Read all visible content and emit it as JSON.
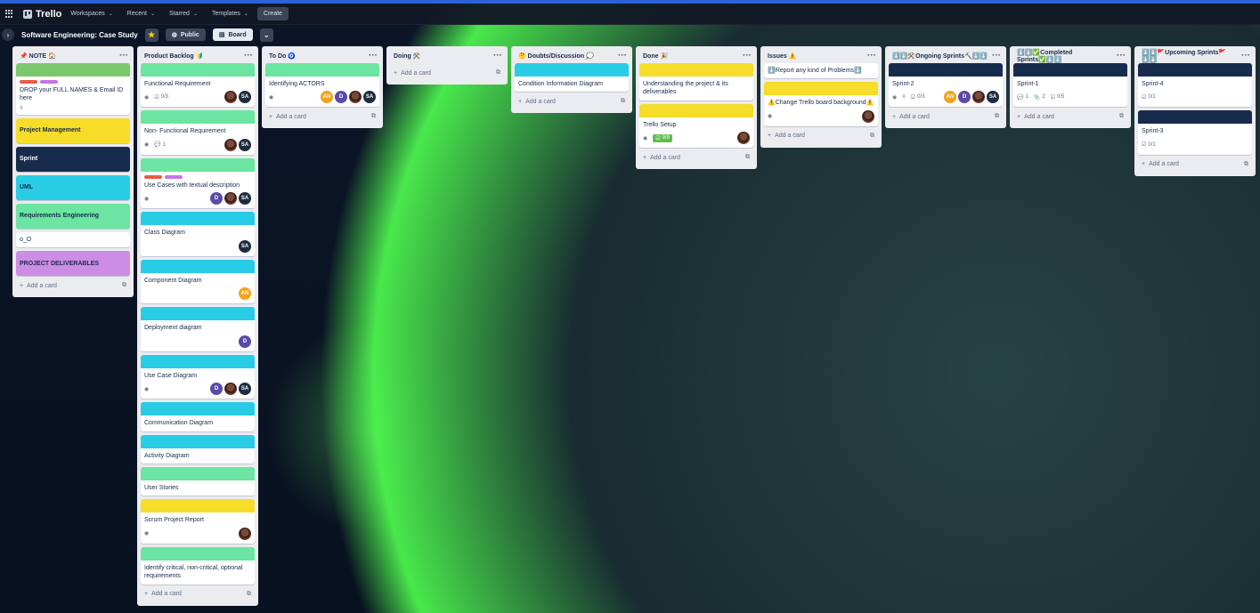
{
  "app": {
    "brand": "Trello",
    "menu": [
      "Workspaces",
      "Recent",
      "Starred",
      "Templates"
    ],
    "create_label": "Create"
  },
  "board": {
    "title": "Software Engineering: Case Study",
    "visibility": "Public",
    "view": "Board"
  },
  "lists": [
    {
      "title": "📌 NOTE 🏠",
      "cards": [
        {
          "type": "cover",
          "cover": "#7bc86c",
          "title": "DROP your FULL NAMES & Email ID here",
          "labels": [
            "#eb5a46",
            "#c377e0"
          ]
        },
        {
          "type": "solid",
          "color": "#f5dd29",
          "text": "Project Management",
          "textColor": "#172b4d"
        },
        {
          "type": "solid",
          "color": "#172b4d",
          "text": "Sprint",
          "textColor": "#ffffff"
        },
        {
          "type": "solid",
          "color": "#29cce5",
          "text": "UML",
          "textColor": "#172b4d"
        },
        {
          "type": "solid",
          "color": "#6be5a1",
          "text": "Requirements Engineering",
          "textColor": "#172b4d"
        },
        {
          "type": "plain",
          "title": "o_O"
        },
        {
          "type": "solid",
          "color": "#cd8de5",
          "text": "PROJECT DELIVERABLES",
          "textColor": "#172b4d"
        }
      ],
      "add_label": "Add a card"
    },
    {
      "title": "Product Backlog 🔰",
      "cards": [
        {
          "type": "cover",
          "cover": "#6be5a1",
          "title": "Functional Requirement",
          "badges": [
            "watch",
            "checklist:0/3"
          ],
          "members": [
            "photo",
            "SA"
          ]
        },
        {
          "type": "cover",
          "cover": "#6be5a1",
          "title": "Non- Functional Requirement",
          "badges": [
            "watch",
            "comments:1"
          ],
          "members": [
            "photo",
            "SA"
          ]
        },
        {
          "type": "cover",
          "cover": "#6be5a1",
          "title": "Use Cases with textual description",
          "labels": [
            "#eb5a46",
            "#c377e0"
          ],
          "badges": [
            "watch"
          ],
          "members": [
            "D",
            "photo",
            "SA"
          ]
        },
        {
          "type": "cover",
          "cover": "#29cce5",
          "title": "Class Diagram",
          "members": [
            "SA"
          ]
        },
        {
          "type": "cover",
          "cover": "#29cce5",
          "title": "Component Diagram",
          "members": [
            "AN"
          ]
        },
        {
          "type": "cover",
          "cover": "#29cce5",
          "title": "Deployment diagram",
          "members": [
            "D"
          ]
        },
        {
          "type": "cover",
          "cover": "#29cce5",
          "title": "Use Case Diagram",
          "badges": [
            "watch"
          ],
          "members": [
            "D",
            "photo",
            "SA"
          ]
        },
        {
          "type": "cover",
          "cover": "#29cce5",
          "title": "Communication Diagram"
        },
        {
          "type": "cover",
          "cover": "#29cce5",
          "title": "Activity Diagram"
        },
        {
          "type": "cover",
          "cover": "#6be5a1",
          "title": "User Stories"
        },
        {
          "type": "cover",
          "cover": "#f5dd29",
          "title": "Scrum Project Report",
          "badges": [
            "watch"
          ],
          "members": [
            "photo"
          ]
        },
        {
          "type": "cover",
          "cover": "#6be5a1",
          "title": "Identify critical, non-critical, optional requirements"
        }
      ],
      "add_label": "Add a card"
    },
    {
      "title": "To Do 🧿",
      "cards": [
        {
          "type": "cover",
          "cover": "#6be5a1",
          "title": "Identifying ACTORS",
          "badges": [
            "watch"
          ],
          "members": [
            "AN",
            "D",
            "photo",
            "SA"
          ]
        }
      ],
      "add_label": "Add a card"
    },
    {
      "title": "Doing ⚒️",
      "cards": [],
      "add_label": "Add a card"
    },
    {
      "title": "🤔 Doubts/Discussion 💭",
      "cards": [
        {
          "type": "cover",
          "cover": "#29cce5",
          "title": "Condition Information Diagram"
        }
      ],
      "add_label": "Add a card"
    },
    {
      "title": "Done 🎉",
      "cards": [
        {
          "type": "cover",
          "cover": "#f5dd29",
          "title": "Understanding the project & its deliverables"
        },
        {
          "type": "cover",
          "cover": "#f5dd29",
          "title": "Trello Setup",
          "badges": [
            "watch",
            "done:9/9"
          ],
          "members": [
            "photo"
          ]
        }
      ],
      "add_label": "Add a card"
    },
    {
      "title": "Issues ⚠️",
      "cards": [
        {
          "type": "plain",
          "title": "⬇️Report any kind of Problems⬇️"
        },
        {
          "type": "cover",
          "cover": "#f5dd29",
          "title": "⚠️Change Trello board background⚠️",
          "badges": [
            "watch"
          ],
          "members": [
            "photo"
          ]
        }
      ],
      "add_label": "Add a card"
    },
    {
      "title": "⬇️⬇️⚒️Ongoing Sprints⛏️⬇️⬇️",
      "cards": [
        {
          "type": "cover",
          "cover": "#172b4d",
          "title": "Sprint-2",
          "badges": [
            "watch",
            "desc",
            "checklist:0/3"
          ],
          "members": [
            "AN",
            "D",
            "photo",
            "SA"
          ]
        }
      ],
      "add_label": "Add a card"
    },
    {
      "title": "⬇️⬇️✅Completed Sprints✅⬇️⬇️",
      "cards": [
        {
          "type": "cover",
          "cover": "#172b4d",
          "title": "Sprint-1",
          "badges": [
            "comments:1",
            "attach:2",
            "checklist:0/5"
          ]
        }
      ],
      "add_label": "Add a card"
    },
    {
      "title": "⬇️⬇️🚩Upcoming Sprints🚩⬇️⬇️",
      "cards": [
        {
          "type": "cover",
          "cover": "#172b4d",
          "title": "Sprint-4",
          "badges": [
            "checklist:0/1"
          ]
        },
        {
          "type": "cover",
          "cover": "#172b4d",
          "title": "Sprint-3",
          "badges": [
            "checklist:0/1"
          ]
        }
      ],
      "add_label": "Add a card"
    }
  ]
}
